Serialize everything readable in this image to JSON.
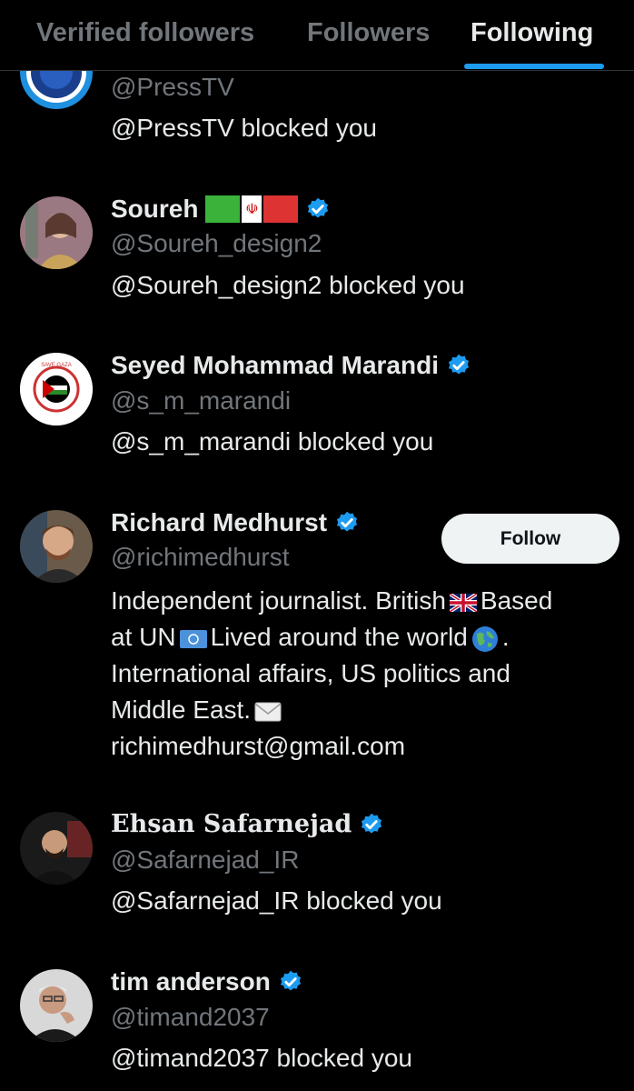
{
  "tabs": {
    "verified": "Verified followers",
    "followers": "Followers",
    "following": "Following",
    "active": "following",
    "accent_color": "#1d9bf0"
  },
  "users": [
    {
      "name": "",
      "handle": "@PressTV",
      "status": "@PressTV blocked you"
    },
    {
      "name": "Soureh",
      "handle": "@Soureh_design2",
      "status": "@Soureh_design2 blocked you",
      "verified": true,
      "name_suffix": "Iran flag emoji"
    },
    {
      "name": "Seyed Mohammad Marandi",
      "handle": "@s_m_marandi",
      "status": "@s_m_marandi blocked you",
      "verified": true
    },
    {
      "name": "Richard Medhurst",
      "handle": "@richimedhurst",
      "verified": true,
      "follow_label": "Follow",
      "bio": {
        "line1a": "Independent journalist. British",
        "line1b": "Based",
        "line2a": "at UN",
        "line2b": "Lived around the world",
        "line2c": ".",
        "line3": "International affairs, US politics and",
        "line4": "Middle East.",
        "line5": "richimedhurst@gmail.com"
      }
    },
    {
      "name": "Ehsan Safarnejad",
      "handle": "@Safarnejad_IR",
      "status": "@Safarnejad_IR blocked you",
      "verified": true
    },
    {
      "name": "tim anderson",
      "handle": "@timand2037",
      "status": "@timand2037 blocked you",
      "verified": true
    }
  ],
  "icons": {
    "verified": "verified-badge-icon",
    "uk_flag": "uk-flag-icon",
    "un_flag": "un-flag-icon",
    "globe": "globe-icon",
    "envelope": "envelope-icon"
  }
}
